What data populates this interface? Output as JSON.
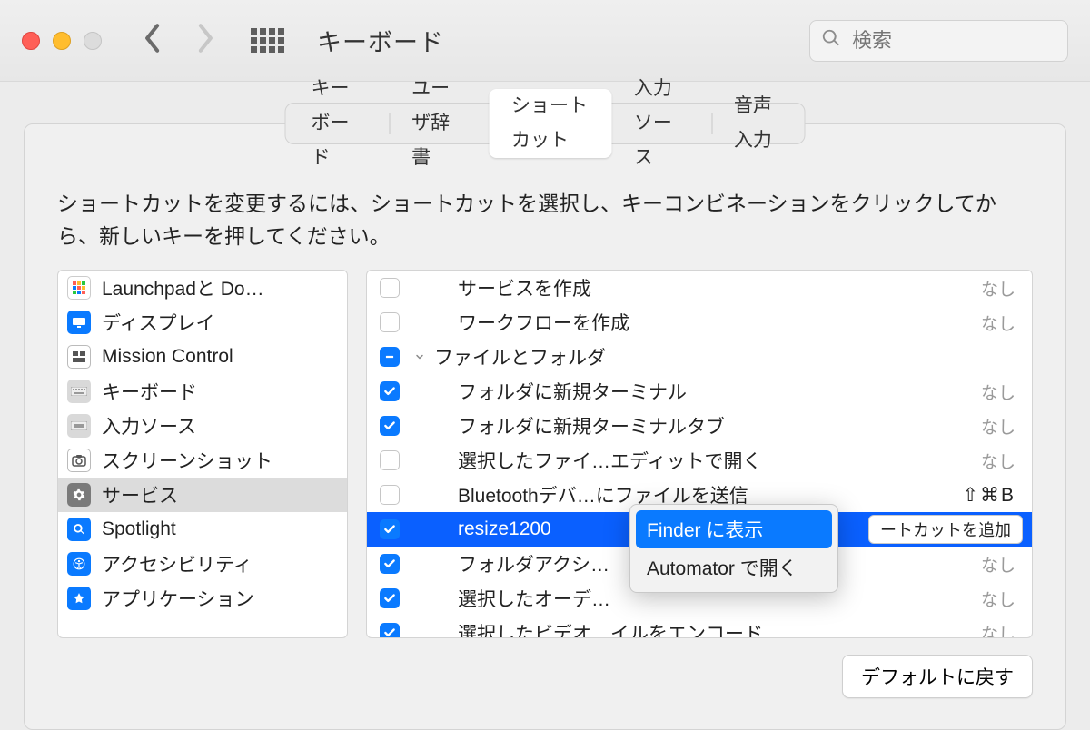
{
  "window_title": "キーボード",
  "search_placeholder": "検索",
  "tabs": {
    "t0": "キーボード",
    "t1": "ユーザ辞書",
    "t2": "ショートカット",
    "t3": "入力ソース",
    "t4": "音声入力"
  },
  "instructions": "ショートカットを変更するには、ショートカットを選択し、キーコンビネーションをクリックしてから、新しいキーを押してください。",
  "categories": [
    {
      "label": "Launchpadと Do…"
    },
    {
      "label": "ディスプレイ"
    },
    {
      "label": "Mission Control"
    },
    {
      "label": "キーボード"
    },
    {
      "label": "入力ソース"
    },
    {
      "label": "スクリーンショット"
    },
    {
      "label": "サービス"
    },
    {
      "label": "Spotlight"
    },
    {
      "label": "アクセシビリティ"
    },
    {
      "label": "アプリケーション"
    }
  ],
  "value_none": "なし",
  "shortcuts": [
    {
      "checked": "unchecked",
      "indent": 2,
      "label": "サービスを作成",
      "value_key": "none"
    },
    {
      "checked": "unchecked",
      "indent": 2,
      "label": "ワークフローを作成",
      "value_key": "none"
    },
    {
      "checked": "mixed",
      "indent": 1,
      "label": "ファイルとフォルダ",
      "value_key": "",
      "disclosure": true
    },
    {
      "checked": "checked",
      "indent": 2,
      "label": "フォルダに新規ターミナル",
      "value_key": "none"
    },
    {
      "checked": "checked",
      "indent": 2,
      "label": "フォルダに新規ターミナルタブ",
      "value_key": "none"
    },
    {
      "checked": "unchecked",
      "indent": 2,
      "label": "選択したファイ…エディットで開く",
      "value_key": "none"
    },
    {
      "checked": "unchecked",
      "indent": 2,
      "label": "Bluetoothデバ…にファイルを送信",
      "value_key": "bt"
    },
    {
      "checked": "checked",
      "indent": 2,
      "label": "resize1200",
      "value_key": "add",
      "selected": true
    },
    {
      "checked": "checked",
      "indent": 2,
      "label": "フォルダアクシ…",
      "value_key": "none"
    },
    {
      "checked": "checked",
      "indent": 2,
      "label": "選択したオーデ…",
      "value_key": "none"
    },
    {
      "checked": "checked",
      "indent": 2,
      "label": "選択したビデオ…イルをエンコード",
      "value_key": "none"
    }
  ],
  "shortcut_values": {
    "none": "なし",
    "bt": "⇧⌘B",
    "add": "ートカットを追加"
  },
  "context_menu": {
    "item0": "Finder に表示",
    "item1": "Automator で開く"
  },
  "defaults_button": "デフォルトに戻す"
}
